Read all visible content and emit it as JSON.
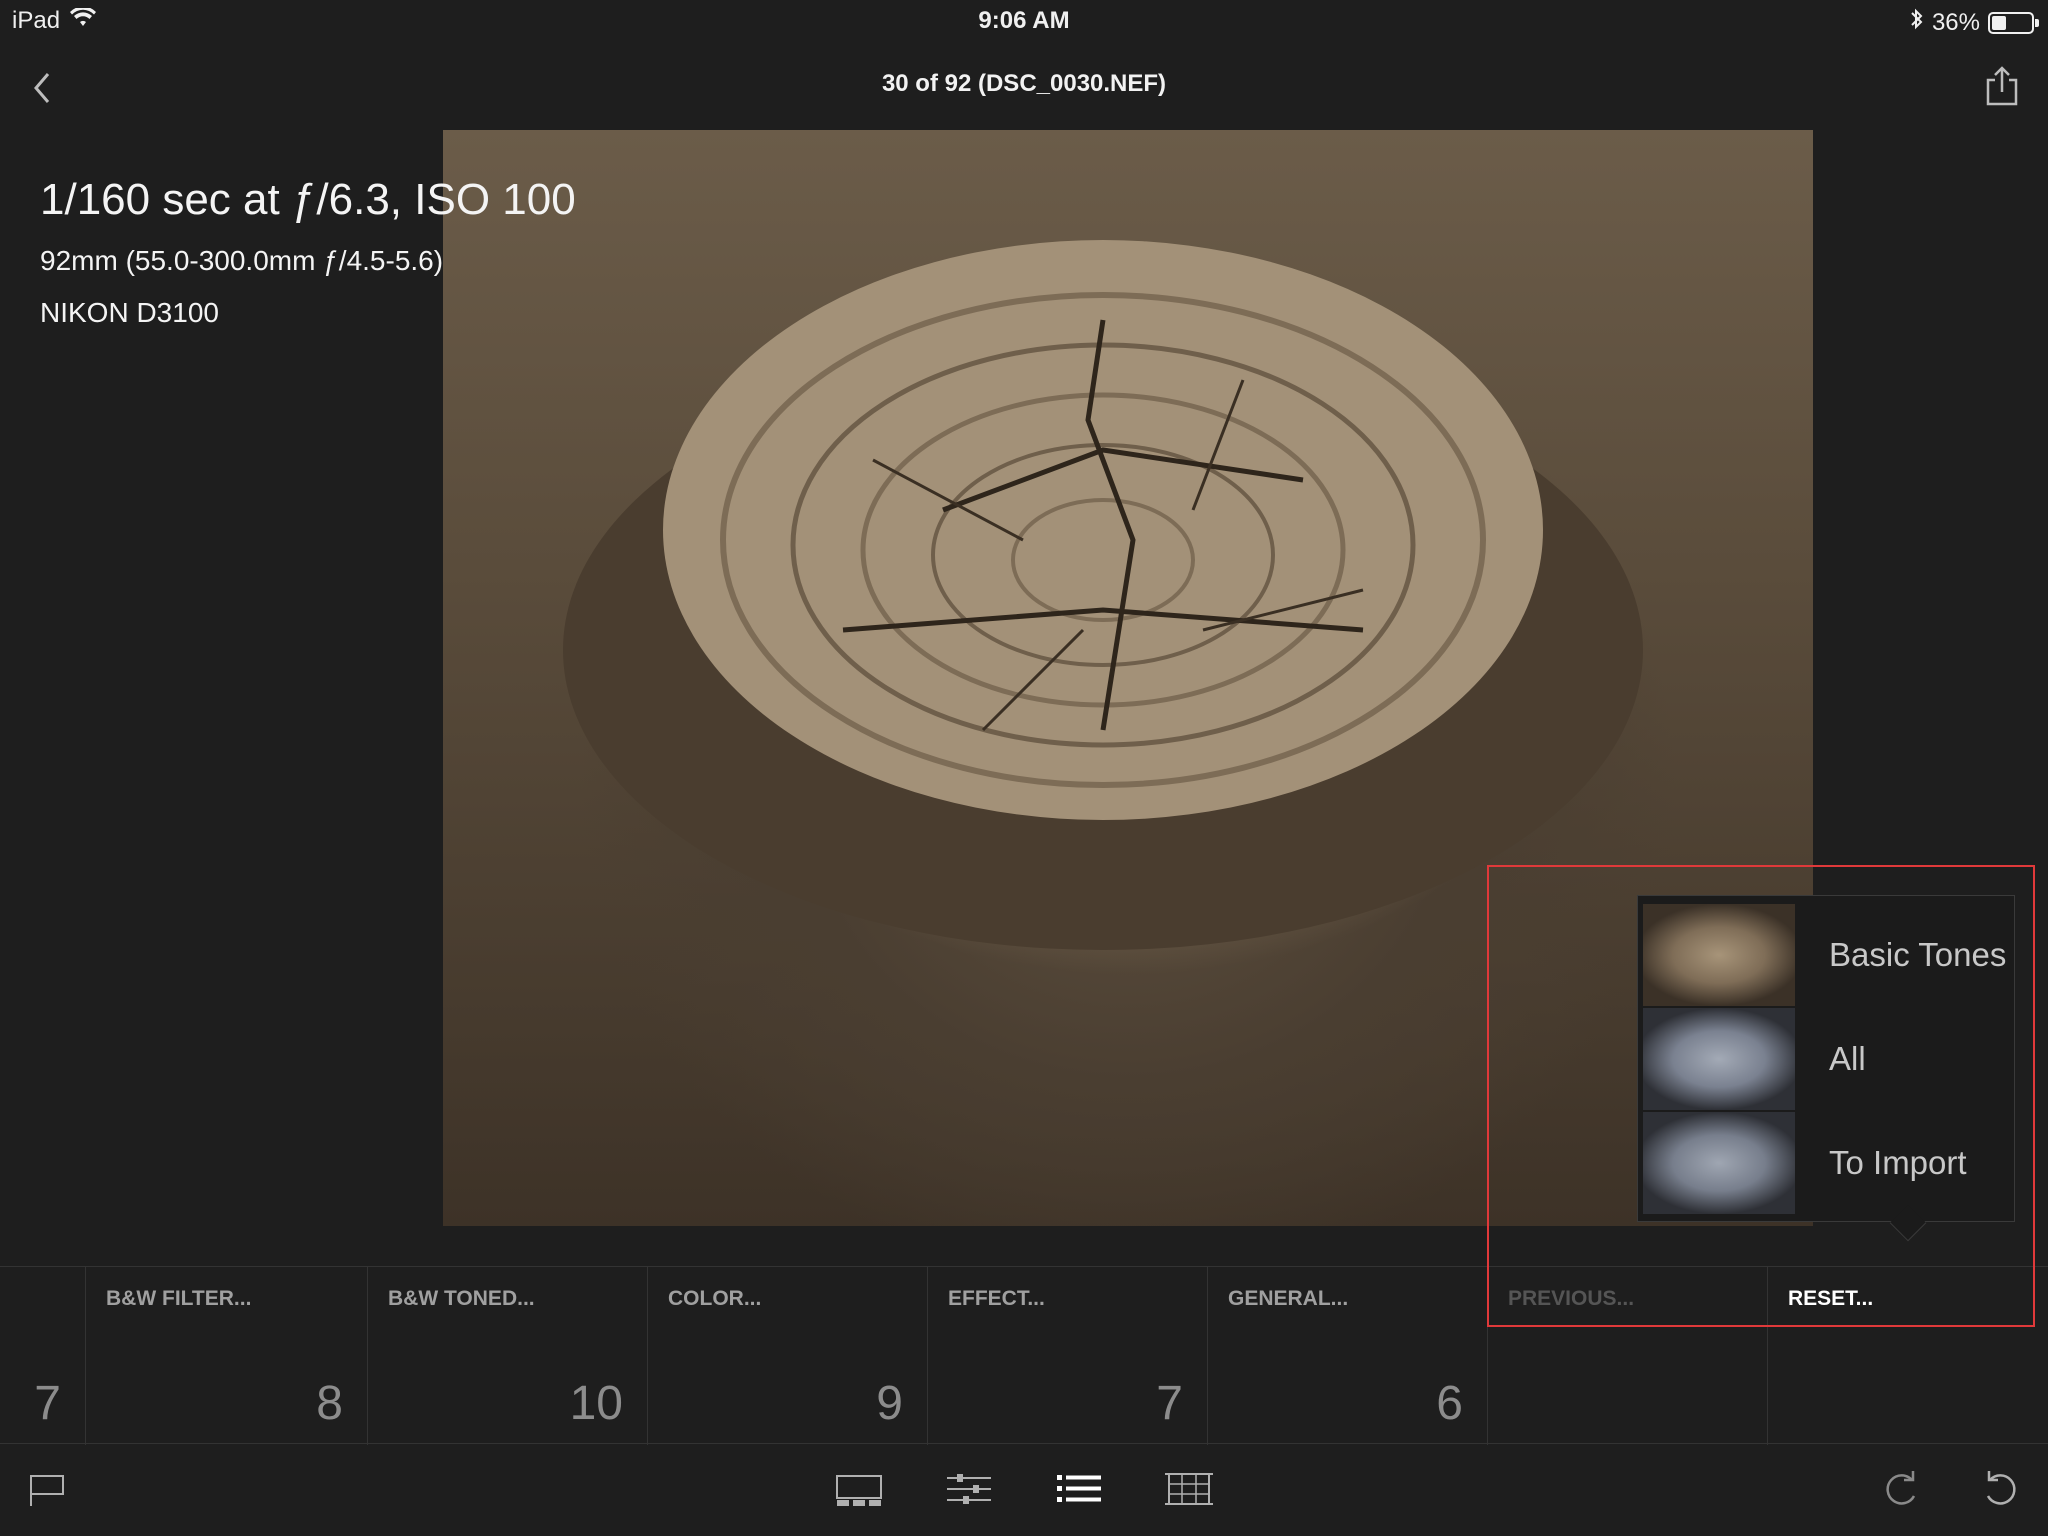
{
  "status_bar": {
    "device": "iPad",
    "time": "9:06 AM",
    "battery": "36%",
    "battery_level": 0.36
  },
  "nav": {
    "title": "30 of 92 (DSC_0030.NEF)"
  },
  "exif": {
    "exposure": "1/160 sec at ƒ/6.3, ISO 100",
    "lens": "92mm (55.0-300.0mm ƒ/4.5-5.6)",
    "camera": "NIKON D3100"
  },
  "popup": {
    "items": [
      {
        "label": "Basic Tones",
        "tone": "sepia"
      },
      {
        "label": "All",
        "tone": "cool"
      },
      {
        "label": "To Import",
        "tone": "cool"
      }
    ]
  },
  "presets": [
    {
      "title": "",
      "count": "7"
    },
    {
      "title": "B&W FILTER...",
      "count": "8"
    },
    {
      "title": "B&W TONED...",
      "count": "10"
    },
    {
      "title": "COLOR...",
      "count": "9"
    },
    {
      "title": "EFFECT...",
      "count": "7"
    },
    {
      "title": "GENERAL...",
      "count": "6"
    },
    {
      "title": "PREVIOUS...",
      "count": ""
    },
    {
      "title": "RESET...",
      "count": ""
    }
  ],
  "toolbar": {
    "icons": [
      "flag-icon",
      "filmstrip-icon",
      "adjustments-icon",
      "presets-list-icon",
      "crop-grid-icon",
      "redo-icon",
      "undo-icon"
    ]
  },
  "colors": {
    "background": "#1e1e1e",
    "highlight": "#e0393a",
    "accent_text": "#ffffff",
    "dim_text": "#8c8c8c"
  }
}
